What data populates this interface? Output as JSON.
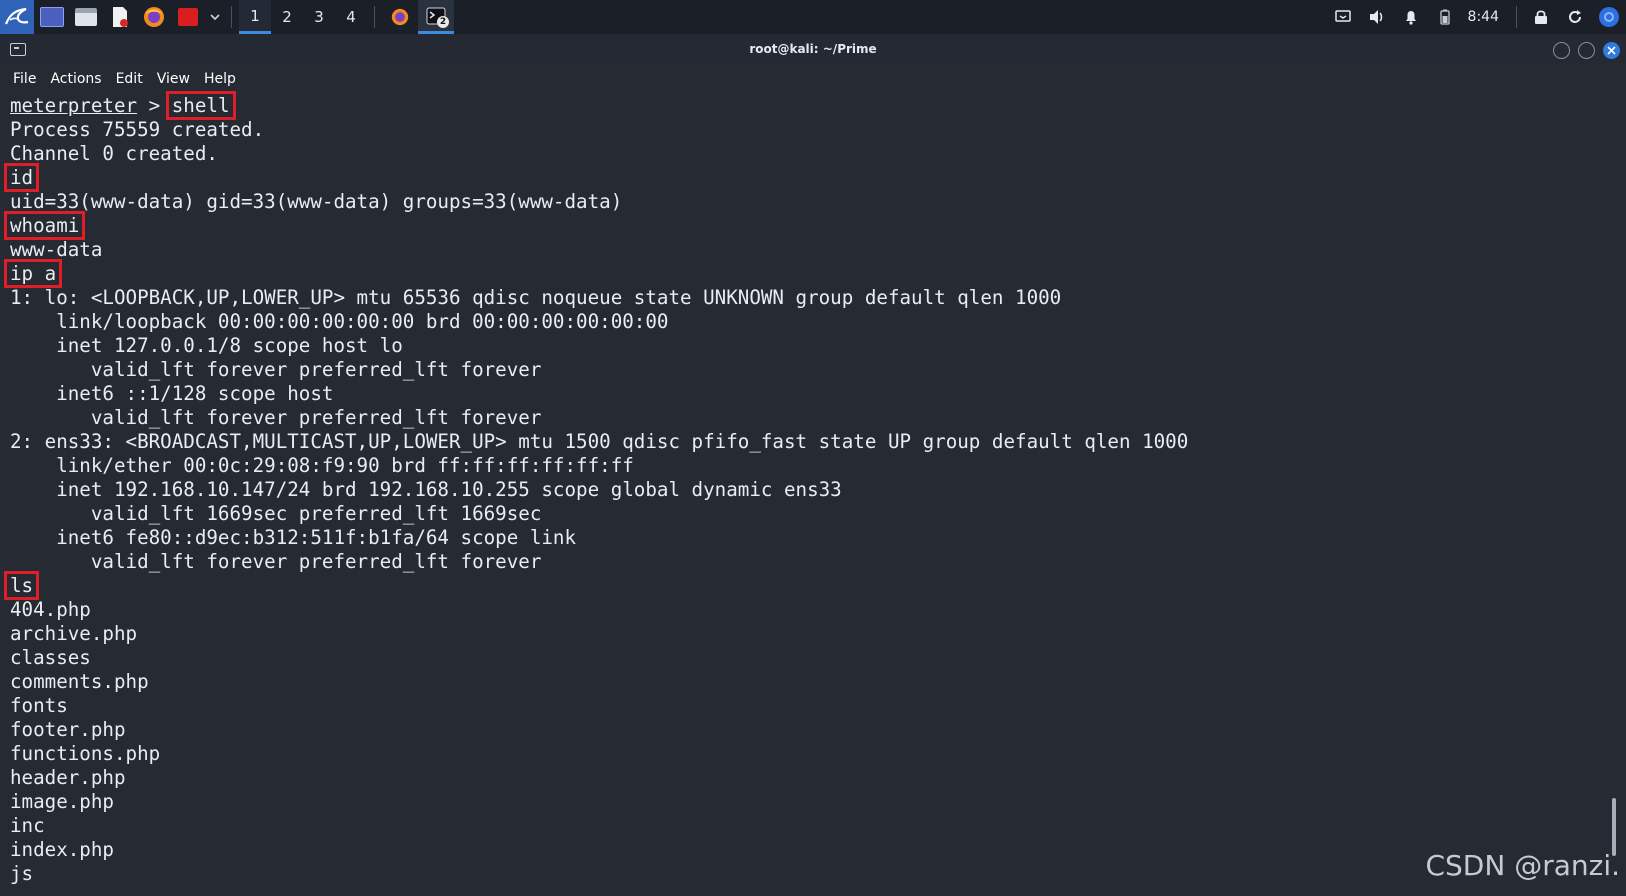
{
  "taskbar": {
    "workspaces": [
      "1",
      "2",
      "3",
      "4"
    ],
    "active_workspace": "1",
    "terminal_window_count": "2",
    "clock": "8:44"
  },
  "window": {
    "title": "root@kali: ~/Prime",
    "menu": [
      "File",
      "Actions",
      "Edit",
      "View",
      "Help"
    ]
  },
  "terminal": {
    "prompt_word": "meterpreter",
    "prompt_sep": " > ",
    "lines": [
      {
        "type": "cmd",
        "text": "shell"
      },
      {
        "type": "out",
        "text": "Process 75559 created."
      },
      {
        "type": "out",
        "text": "Channel 0 created."
      },
      {
        "type": "cmd",
        "text": "id"
      },
      {
        "type": "out",
        "text": "uid=33(www-data) gid=33(www-data) groups=33(www-data)"
      },
      {
        "type": "cmd",
        "text": "whoami"
      },
      {
        "type": "out",
        "text": "www-data"
      },
      {
        "type": "cmd",
        "text": "ip a"
      },
      {
        "type": "out",
        "text": "1: lo: <LOOPBACK,UP,LOWER_UP> mtu 65536 qdisc noqueue state UNKNOWN group default qlen 1000"
      },
      {
        "type": "out",
        "text": "    link/loopback 00:00:00:00:00:00 brd 00:00:00:00:00:00"
      },
      {
        "type": "out",
        "text": "    inet 127.0.0.1/8 scope host lo"
      },
      {
        "type": "out",
        "text": "       valid_lft forever preferred_lft forever"
      },
      {
        "type": "out",
        "text": "    inet6 ::1/128 scope host"
      },
      {
        "type": "out",
        "text": "       valid_lft forever preferred_lft forever"
      },
      {
        "type": "out",
        "text": "2: ens33: <BROADCAST,MULTICAST,UP,LOWER_UP> mtu 1500 qdisc pfifo_fast state UP group default qlen 1000"
      },
      {
        "type": "out",
        "text": "    link/ether 00:0c:29:08:f9:90 brd ff:ff:ff:ff:ff:ff"
      },
      {
        "type": "out",
        "text": "    inet 192.168.10.147/24 brd 192.168.10.255 scope global dynamic ens33"
      },
      {
        "type": "out",
        "text": "       valid_lft 1669sec preferred_lft 1669sec"
      },
      {
        "type": "out",
        "text": "    inet6 fe80::d9ec:b312:511f:b1fa/64 scope link"
      },
      {
        "type": "out",
        "text": "       valid_lft forever preferred_lft forever"
      },
      {
        "type": "cmd",
        "text": "ls"
      },
      {
        "type": "out",
        "text": "404.php"
      },
      {
        "type": "out",
        "text": "archive.php"
      },
      {
        "type": "out",
        "text": "classes"
      },
      {
        "type": "out",
        "text": "comments.php"
      },
      {
        "type": "out",
        "text": "fonts"
      },
      {
        "type": "out",
        "text": "footer.php"
      },
      {
        "type": "out",
        "text": "functions.php"
      },
      {
        "type": "out",
        "text": "header.php"
      },
      {
        "type": "out",
        "text": "image.php"
      },
      {
        "type": "out",
        "text": "inc"
      },
      {
        "type": "out",
        "text": "index.php"
      },
      {
        "type": "out",
        "text": "js"
      }
    ]
  },
  "watermark": "CSDN @ranzi.",
  "colors": {
    "highlight_box": "#e01e2a",
    "terminal_bg": "#252a33",
    "accent": "#3a8dde"
  },
  "icons": {
    "panel_left": [
      "kali-menu-icon",
      "desktop-icon",
      "file-manager-icon",
      "text-editor-icon",
      "firefox-icon",
      "terminal-red-icon",
      "chevron-down-icon"
    ],
    "panel_right": [
      "screen-icon",
      "volume-icon",
      "notification-bell-icon",
      "battery-icon",
      "lock-icon",
      "refresh-icon",
      "chrome-icon"
    ]
  }
}
